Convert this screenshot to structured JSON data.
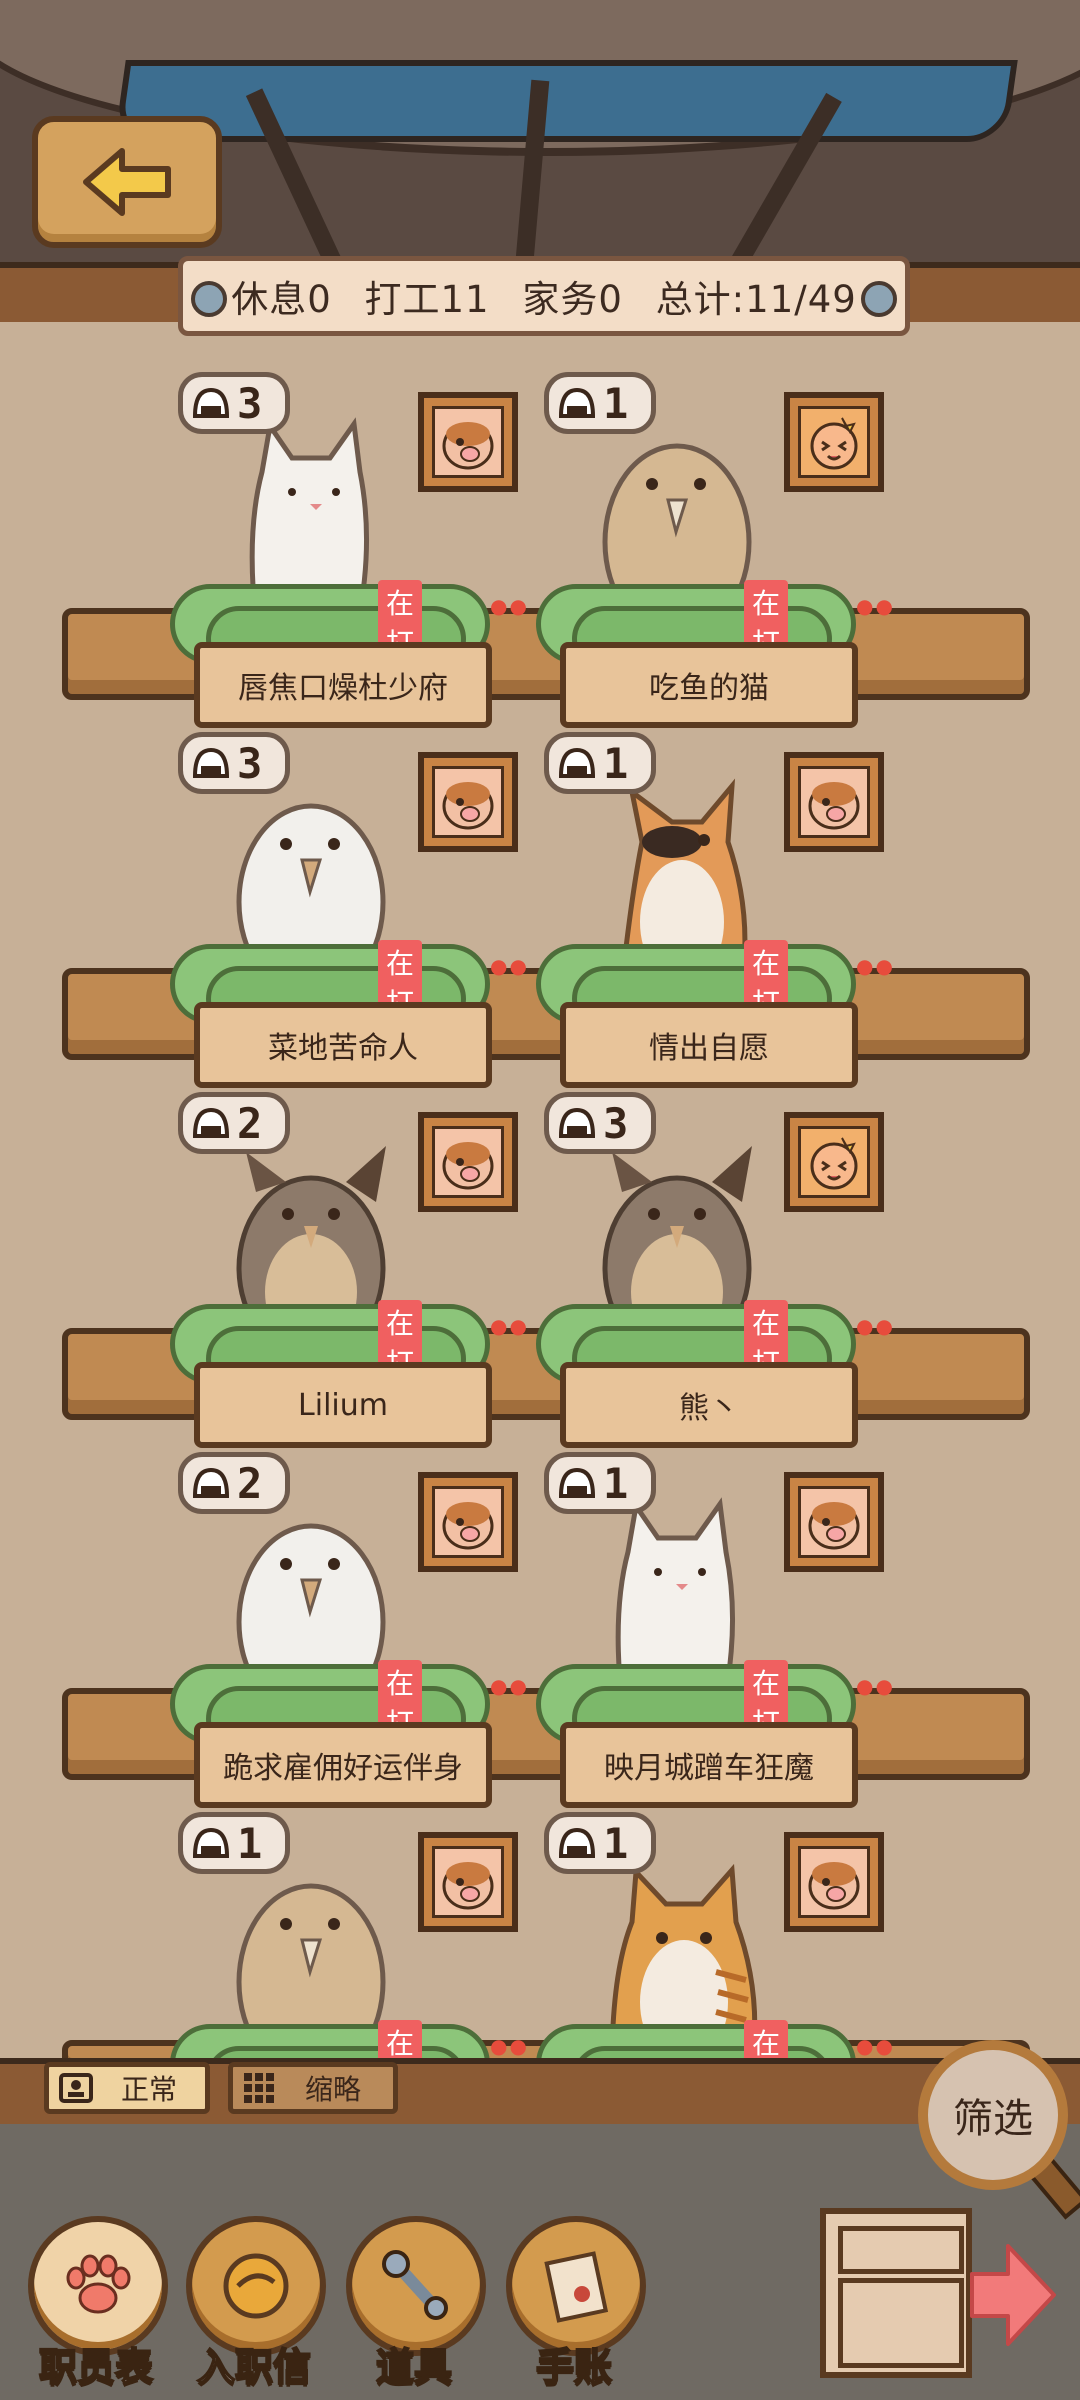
{
  "stats": {
    "rest": "休息0",
    "work": "打工11",
    "chores": "家务0",
    "total": "总计:11/49"
  },
  "staff": [
    {
      "name": "唇焦口燥杜少府",
      "count": "3",
      "status": "在打工",
      "animal": "cat-white",
      "portrait": "hamster"
    },
    {
      "name": "吃鱼的猫",
      "count": "1",
      "status": "在打工",
      "animal": "bird-tan",
      "portrait": "gold-face"
    },
    {
      "name": "菜地苦命人",
      "count": "3",
      "status": "在打工",
      "animal": "bird-white",
      "portrait": "hamster"
    },
    {
      "name": "情出自愿",
      "count": "1",
      "status": "在打工",
      "animal": "corgi",
      "portrait": "hamster"
    },
    {
      "name": "Lilium",
      "count": "2",
      "status": "在打工",
      "animal": "owl",
      "portrait": "hamster"
    },
    {
      "name": "熊丶",
      "count": "3",
      "status": "在打工",
      "animal": "owl",
      "portrait": "gold-face"
    },
    {
      "name": "跪求雇佣好运伴身",
      "count": "2",
      "status": "在打工",
      "animal": "bird-white",
      "portrait": "hamster"
    },
    {
      "name": "映月城蹭车狂魔",
      "count": "1",
      "status": "在打工",
      "animal": "cat-white",
      "portrait": "hamster"
    },
    {
      "name": "",
      "count": "1",
      "status": "在打工",
      "animal": "bird-tan",
      "portrait": "hamster"
    },
    {
      "name": "",
      "count": "1",
      "status": "在打工",
      "animal": "cat-orange",
      "portrait": "hamster"
    }
  ],
  "view_toggles": {
    "normal": "正常",
    "compact": "缩略"
  },
  "filter_label": "筛选",
  "nav": [
    {
      "label": "职员表",
      "icon": "paw-icon"
    },
    {
      "label": "入职信",
      "icon": "orb-icon"
    },
    {
      "label": "道具",
      "icon": "wrench-icon"
    },
    {
      "label": "手账",
      "icon": "notebook-icon"
    }
  ]
}
